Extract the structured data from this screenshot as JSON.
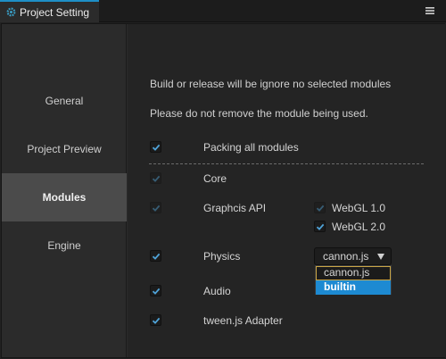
{
  "window": {
    "tab_title": "Project Setting"
  },
  "sidebar": {
    "items": [
      {
        "label": "General",
        "active": false
      },
      {
        "label": "Project Preview",
        "active": false
      },
      {
        "label": "Modules",
        "active": true
      },
      {
        "label": "Engine",
        "active": false
      }
    ]
  },
  "content": {
    "info_line1": "Build or release will be ignore no selected modules",
    "info_line2": "Please do not remove the module being used.",
    "pack_all": {
      "label": "Packing all modules",
      "checked": true
    },
    "modules": [
      {
        "label": "Core",
        "checked": true,
        "disabled": true
      },
      {
        "label": "Graphcis API",
        "checked": true,
        "disabled": true
      },
      {
        "label": "Physics",
        "checked": true,
        "disabled": false
      },
      {
        "label": "Audio",
        "checked": true,
        "disabled": false
      },
      {
        "label": "tween.js Adapter",
        "checked": true,
        "disabled": false
      }
    ],
    "graphics_options": [
      {
        "label": "WebGL 1.0",
        "checked": true,
        "disabled": true
      },
      {
        "label": "WebGL 2.0",
        "checked": true,
        "disabled": false
      }
    ],
    "physics_select": {
      "value": "cannon.js",
      "options": [
        "cannon.js",
        "builtin"
      ]
    }
  },
  "colors": {
    "accent": "#1e8fc6",
    "check": "#4fa3d8",
    "selected_option": "#1d8ad2",
    "hover_outline": "#c9a545"
  }
}
